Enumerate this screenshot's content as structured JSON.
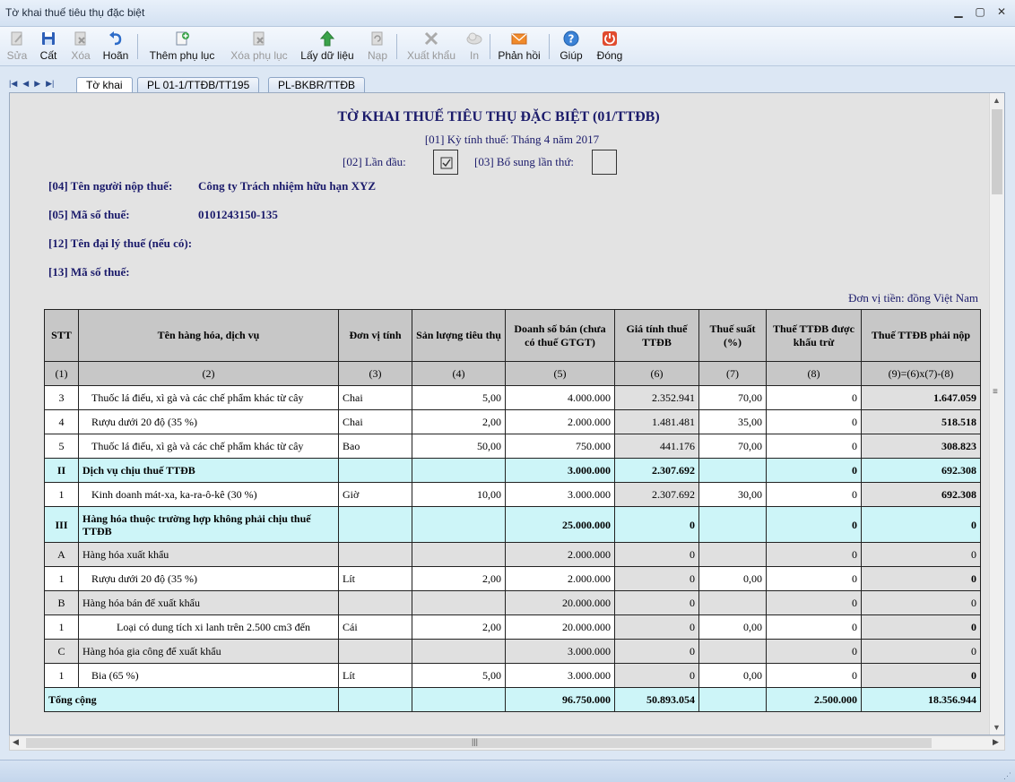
{
  "window": {
    "title": "Tờ khai thuế tiêu thụ đặc biệt"
  },
  "toolbar": {
    "edit": "Sửa",
    "save": "Cất",
    "delete": "Xóa",
    "undo": "Hoãn",
    "add_appendix": "Thêm phụ lục",
    "remove_appendix": "Xóa phụ lục",
    "get_data": "Lấy dữ liệu",
    "submit": "Nạp",
    "export": "Xuất khẩu",
    "print": "In",
    "feedback": "Phản hồi",
    "help": "Giúp",
    "close": "Đóng"
  },
  "tabs": [
    "Tờ khai",
    "PL 01-1/TTĐB/TT195",
    "PL-BKBR/TTĐB"
  ],
  "form": {
    "title": "TỜ KHAI THUẾ TIÊU THỤ ĐẶC BIỆT (01/TTĐB)",
    "period_label": "[01] Kỳ tính thuế:",
    "period_value": "Tháng 4 năm 2017",
    "first_time_label": "[02] Lần đầu:",
    "supplement_label": "[03] Bổ sung lần thứ:",
    "taxpayer_label": "[04] Tên người nộp thuế:",
    "taxpayer_value": "Công ty Trách nhiệm hữu hạn XYZ",
    "tax_code_label": "[05] Mã số thuế:",
    "tax_code_value": "0101243150-135",
    "agent_label": "[12] Tên đại lý thuế (nếu có):",
    "agent_tax_code_label": "[13] Mã số thuế:",
    "currency_note": "Đơn vị tiền: đồng Việt Nam"
  },
  "table": {
    "headers": [
      "STT",
      "Tên hàng hóa, dịch vụ",
      "Đơn vị tính",
      "Sản lượng tiêu thụ",
      "Doanh số bán (chưa có thuế GTGT)",
      "Giá tính thuế TTĐB",
      "Thuế suất (%)",
      "Thuế TTĐB được khấu trừ",
      "Thuế TTĐB phải nộp"
    ],
    "index_row": [
      "(1)",
      "(2)",
      "(3)",
      "(4)",
      "(5)",
      "(6)",
      "(7)",
      "(8)",
      "(9)=(6)x(7)-(8)"
    ],
    "rows": [
      {
        "type": "item",
        "stt": "3",
        "name": "Thuốc lá điếu, xì gà và các chế phẩm khác từ cây",
        "unit": "Chai",
        "qty": "5,00",
        "sales": "4.000.000",
        "price": "2.352.941",
        "rate": "70,00",
        "deduct": "0",
        "pay": "1.647.059",
        "indent": 1
      },
      {
        "type": "item",
        "stt": "4",
        "name": "Rượu dưới 20 độ (35 %)",
        "unit": "Chai",
        "qty": "2,00",
        "sales": "2.000.000",
        "price": "1.481.481",
        "rate": "35,00",
        "deduct": "0",
        "pay": "518.518",
        "indent": 1
      },
      {
        "type": "item",
        "stt": "5",
        "name": "Thuốc lá điếu, xì gà và các chế phẩm khác từ cây",
        "unit": "Bao",
        "qty": "50,00",
        "sales": "750.000",
        "price": "441.176",
        "rate": "70,00",
        "deduct": "0",
        "pay": "308.823",
        "indent": 1
      },
      {
        "type": "sec",
        "stt": "II",
        "name": "Dịch vụ chịu thuế TTĐB",
        "unit": "",
        "qty": "",
        "sales": "3.000.000",
        "price": "2.307.692",
        "rate": "",
        "deduct": "0",
        "pay": "692.308"
      },
      {
        "type": "item",
        "stt": "1",
        "name": "Kinh doanh mát-xa, ka-ra-ô-kê (30 %)",
        "unit": "Giờ",
        "qty": "10,00",
        "sales": "3.000.000",
        "price": "2.307.692",
        "rate": "30,00",
        "deduct": "0",
        "pay": "692.308",
        "indent": 1
      },
      {
        "type": "sec-tall",
        "stt": "III",
        "name": "Hàng hóa thuộc trường hợp không phải chịu thuế TTĐB",
        "unit": "",
        "qty": "",
        "sales": "25.000.000",
        "price": "0",
        "rate": "",
        "deduct": "0",
        "pay": "0"
      },
      {
        "type": "sub",
        "stt": "A",
        "name": "Hàng hóa xuất khẩu",
        "unit": "",
        "qty": "",
        "sales": "2.000.000",
        "price": "0",
        "rate": "",
        "deduct": "0",
        "pay": "0"
      },
      {
        "type": "item",
        "stt": "1",
        "name": "Rượu dưới 20 độ (35 %)",
        "unit": "Lít",
        "qty": "2,00",
        "sales": "2.000.000",
        "price": "0",
        "rate": "0,00",
        "deduct": "0",
        "pay": "0",
        "indent": 1
      },
      {
        "type": "sub",
        "stt": "B",
        "name": "Hàng hóa bán để xuất khẩu",
        "unit": "",
        "qty": "",
        "sales": "20.000.000",
        "price": "0",
        "rate": "",
        "deduct": "0",
        "pay": "0"
      },
      {
        "type": "item",
        "stt": "1",
        "name": "Loại có dung tích xi lanh trên 2.500 cm3 đến",
        "unit": "Cái",
        "qty": "2,00",
        "sales": "20.000.000",
        "price": "0",
        "rate": "0,00",
        "deduct": "0",
        "pay": "0",
        "indent": 2
      },
      {
        "type": "sub",
        "stt": "C",
        "name": "Hàng hóa gia công để xuất khẩu",
        "unit": "",
        "qty": "",
        "sales": "3.000.000",
        "price": "0",
        "rate": "",
        "deduct": "0",
        "pay": "0"
      },
      {
        "type": "item",
        "stt": "1",
        "name": "Bia (65 %)",
        "unit": "Lít",
        "qty": "5,00",
        "sales": "3.000.000",
        "price": "0",
        "rate": "0,00",
        "deduct": "0",
        "pay": "0",
        "indent": 1
      }
    ],
    "total": {
      "label": "Tổng cộng",
      "sales": "96.750.000",
      "price": "50.893.054",
      "deduct": "2.500.000",
      "pay": "18.356.944"
    }
  }
}
